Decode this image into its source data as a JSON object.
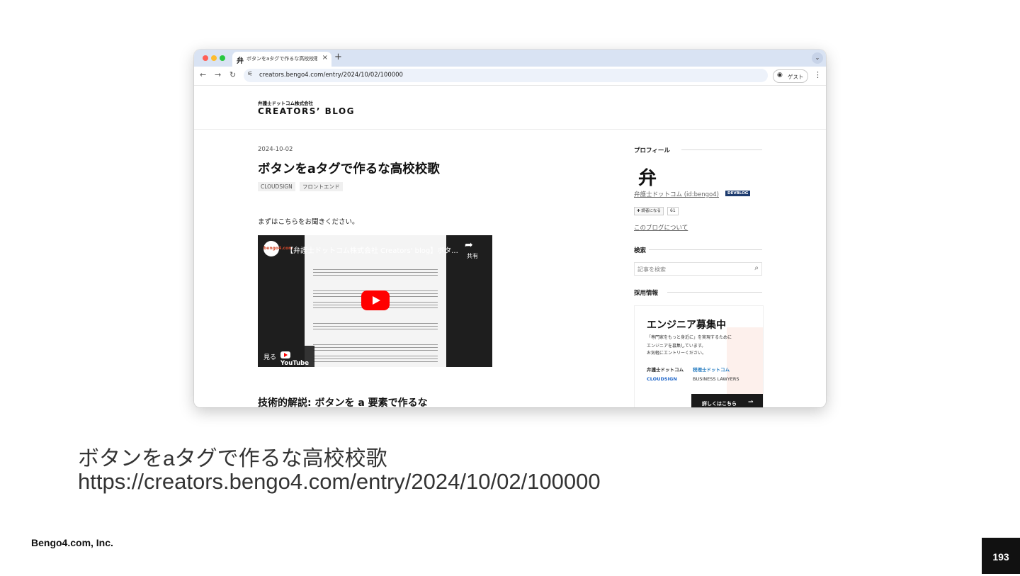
{
  "browser": {
    "tab_title": "ボタンをaタグで作るな高校校歌",
    "tab_favicon": "弁",
    "tab_close": "×",
    "new_tab": "+",
    "tab_menu": "⌄",
    "url": "creators.bengo4.com/entry/2024/10/02/100000",
    "guest_label": "ゲスト",
    "traffic_colors": [
      "#ff5f57",
      "#febc2e",
      "#28c840"
    ]
  },
  "blog": {
    "company": "弁護士ドットコム株式会社",
    "name": "CREATORS’ BLOG"
  },
  "article": {
    "date": "2024-10-02",
    "title": "ボタンをaタグで作るな高校校歌",
    "categories": [
      "CLOUDSIGN",
      "フロントエンド"
    ],
    "intro": "まずはこちらをお聞きください。",
    "video_title": "【弁護士ドットコム株式会社 Creators' blog】ボタ...",
    "video_channel_logo": "bengo4.com",
    "video_share": "共有",
    "video_watch": "見る",
    "video_youtube": "YouTube",
    "section_heading": "技術的解説: ボタンを a 要素で作るな"
  },
  "sidebar": {
    "profile_heading": "プロフィール",
    "profile_icon": "弁",
    "profile_link": "弁護士ドットコム (id:bengo4)",
    "profile_badge": "DEVBLOG",
    "reader_button": "✚ 読者になる",
    "reader_count": "61",
    "about_link": "このブログについて",
    "search_heading": "検索",
    "search_placeholder": "記事を検索",
    "recruit_heading": "採用情報",
    "banner": {
      "title": "エンジニア募集中",
      "lines": [
        "「専門家をもっと身近に」を実現するために",
        "エンジニアを募集しています。",
        "お気軽にエントリーください。"
      ],
      "logos": [
        "弁護士ドットコム",
        "税理士ドットコム",
        "CLOUDSIGN",
        "BUSINESS LAWYERS"
      ],
      "cta": "詳しくはこちら"
    }
  },
  "slide": {
    "title": "ボタンをaタグで作るな高校校歌",
    "url": "https://creators.bengo4.com/entry/2024/10/02/100000",
    "footer": "Bengo4.com, Inc.",
    "page_number": "193"
  }
}
